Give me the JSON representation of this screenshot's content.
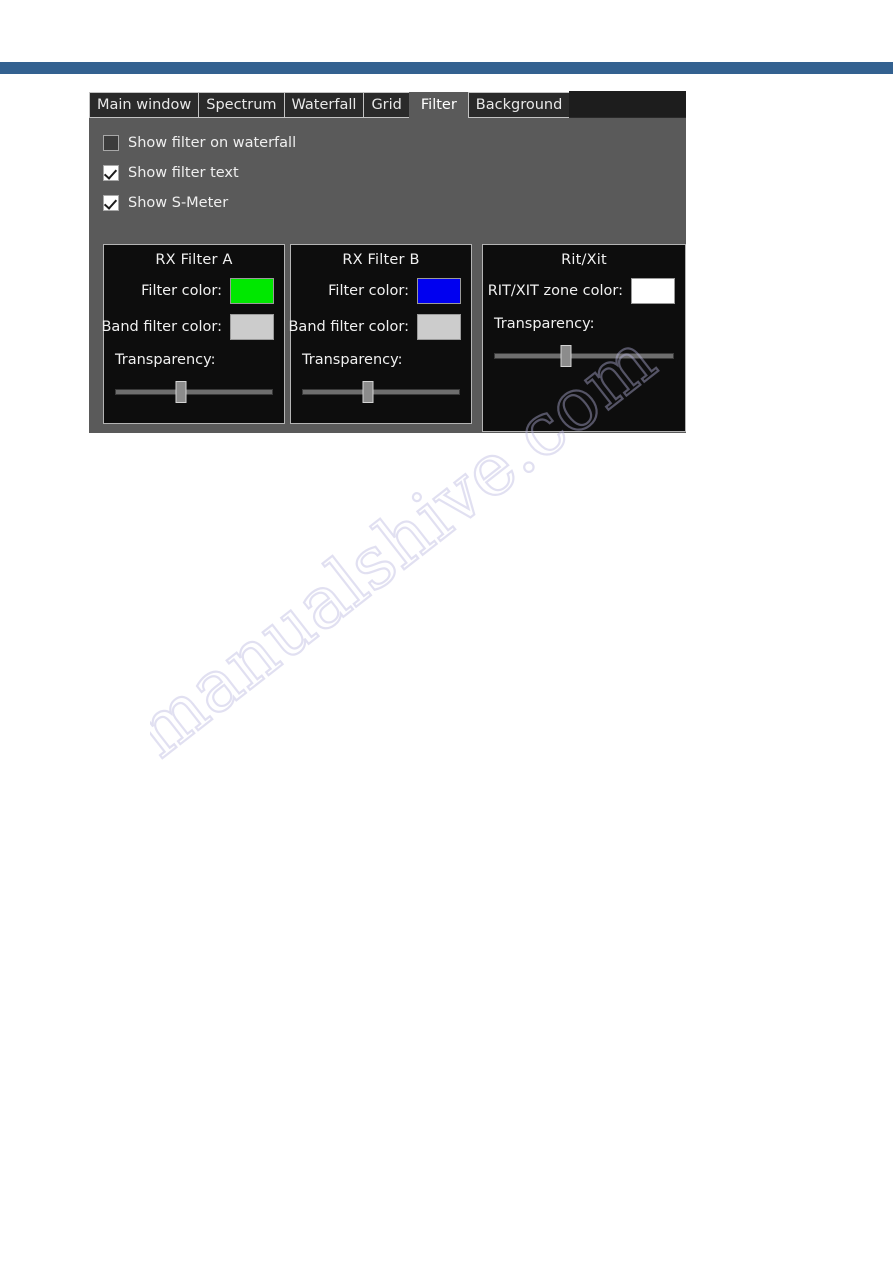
{
  "page": {
    "background_color": "#ffffff",
    "rule_color": "#336190",
    "watermark_text": "manualshive.com"
  },
  "dialog": {
    "tabs": [
      {
        "label": "Main window",
        "selected": false
      },
      {
        "label": "Spectrum",
        "selected": false
      },
      {
        "label": "Waterfall",
        "selected": false
      },
      {
        "label": "Grid",
        "selected": false
      },
      {
        "label": "Filter",
        "selected": true
      },
      {
        "label": "Background",
        "selected": false
      }
    ],
    "checkboxes": [
      {
        "label": "Show filter on waterfall",
        "checked": false
      },
      {
        "label": "Show filter text",
        "checked": true
      },
      {
        "label": "Show S-Meter",
        "checked": true
      }
    ],
    "groups": [
      {
        "id": "rx-filter-a",
        "title": "RX Filter A",
        "fields": [
          {
            "label": "Filter color:",
            "name": "filter-color",
            "color": "#00e800"
          },
          {
            "label": "Band filter color:",
            "name": "band-filter-color",
            "color": "#cccccc"
          }
        ],
        "slider": {
          "label": "Transparency:",
          "value_percent": 42
        }
      },
      {
        "id": "rx-filter-b",
        "title": "RX Filter B",
        "fields": [
          {
            "label": "Filter color:",
            "name": "filter-color",
            "color": "#0000f0"
          },
          {
            "label": "Band filter color:",
            "name": "band-filter-color",
            "color": "#cccccc"
          }
        ],
        "slider": {
          "label": "Transparency:",
          "value_percent": 42
        }
      },
      {
        "id": "rit-xit",
        "title": "Rit/Xit",
        "fields": [
          {
            "label": "RIT/XIT zone color:",
            "name": "rit-xit-zone-color",
            "color": "#ffffff"
          }
        ],
        "slider": {
          "label": "Transparency:",
          "value_percent": 40
        }
      }
    ]
  }
}
